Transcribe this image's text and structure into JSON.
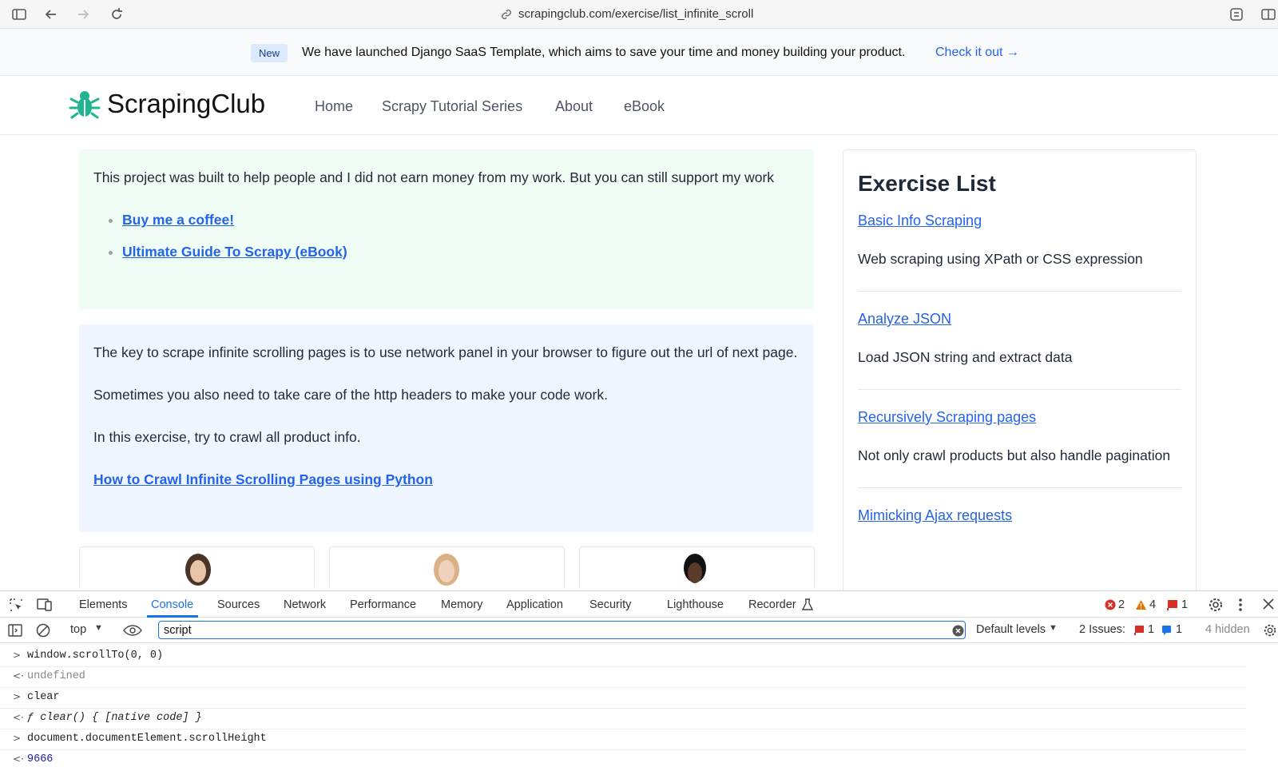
{
  "browser": {
    "url": "scrapingclub.com/exercise/list_infinite_scroll"
  },
  "banner": {
    "badge": "New",
    "text": "We have launched Django SaaS Template, which aims to save your time and money building your product.",
    "link": "Check it out →"
  },
  "nav": {
    "logo": "ScrapingClub",
    "links": [
      "Home",
      "Scrapy Tutorial Series",
      "About",
      "eBook"
    ]
  },
  "support": {
    "text": "This project was built to help people and I did not earn money from my work. But you can still support my work",
    "links": [
      "Buy me a coffee!",
      "Ultimate Guide To Scrapy (eBook)"
    ]
  },
  "info": {
    "paragraphs": [
      "The key to scrape infinite scrolling pages is to use network panel in your browser to figure out the url of next page.",
      "Sometimes you also need to take care of the http headers to make your code work.",
      "In this exercise, try to crawl all product info."
    ],
    "link": "How to Crawl Infinite Scrolling Pages using Python"
  },
  "sidebar": {
    "title": "Exercise List",
    "items": [
      {
        "link": "Basic Info Scraping",
        "desc": "Web scraping using XPath or CSS expression"
      },
      {
        "link": "Analyze JSON",
        "desc": "Load JSON string and extract data"
      },
      {
        "link": "Recursively Scraping pages",
        "desc": "Not only crawl products but also handle pagination"
      },
      {
        "link": "Mimicking Ajax requests",
        "desc": ""
      }
    ]
  },
  "devtools": {
    "tabs": [
      "Elements",
      "Console",
      "Sources",
      "Network",
      "Performance",
      "Memory",
      "Application",
      "Security",
      "Lighthouse",
      "Recorder"
    ],
    "errors": "2",
    "warnings": "4",
    "info_count": "1",
    "context": "top",
    "filter_value": "script",
    "levels": "Default levels",
    "issues_label": "2 Issues:",
    "issues_red": "1",
    "issues_blue": "1",
    "hidden": "4 hidden",
    "console": [
      {
        "kind": "input",
        "text": "window.scrollTo(0, 0)"
      },
      {
        "kind": "output",
        "text": "undefined"
      },
      {
        "kind": "input",
        "text": "clear"
      },
      {
        "kind": "output",
        "text": "ƒ clear() { [native code] }"
      },
      {
        "kind": "input",
        "text": "document.documentElement.scrollHeight"
      },
      {
        "kind": "output",
        "text": "9666"
      }
    ]
  },
  "colors": {
    "accent": "#2563eb",
    "logo_green": "#1fb58f",
    "devtools_blue": "#1a73e8"
  }
}
